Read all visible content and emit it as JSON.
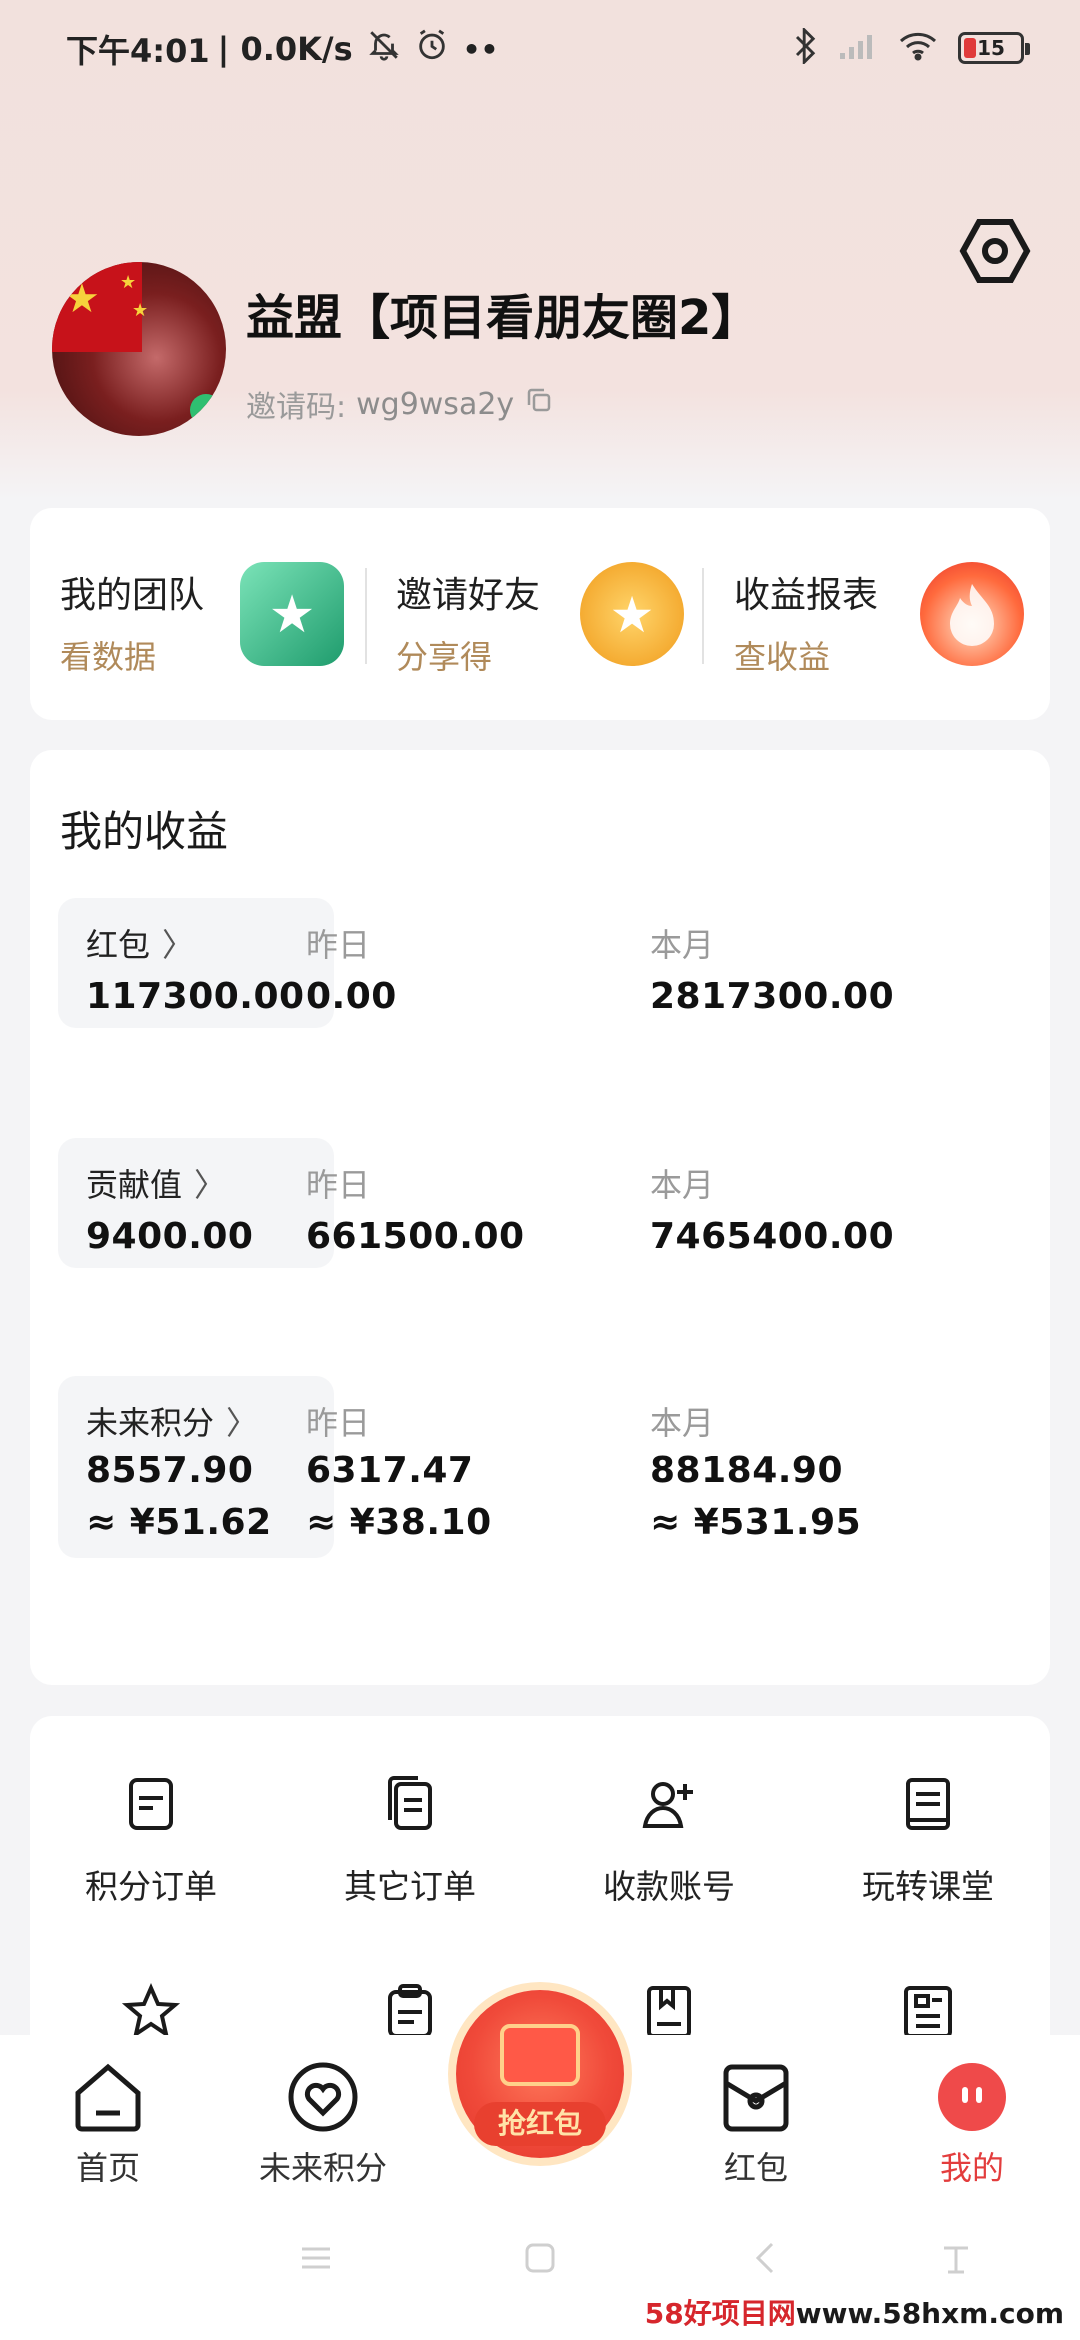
{
  "status_bar": {
    "time": "下午4:01",
    "speed": "| 0.0K/s",
    "battery": "15"
  },
  "profile": {
    "name": "益盟【项目看朋友圈2】",
    "invite_label": "邀请码: ",
    "invite_code": "wg9wsa2y"
  },
  "quick_links": [
    {
      "title": "我的团队",
      "sub": "看数据"
    },
    {
      "title": "邀请好友",
      "sub": "分享得"
    },
    {
      "title": "收益报表",
      "sub": "查收益"
    }
  ],
  "earnings": {
    "title": "我的收益",
    "yesterday_label": "昨日",
    "month_label": "本月",
    "rows": [
      {
        "name": "红包",
        "total": "117300.00",
        "yesterday": "0.00",
        "month": "2817300.00"
      },
      {
        "name": "贡献值",
        "total": "9400.00",
        "yesterday": "661500.00",
        "month": "7465400.00"
      },
      {
        "name": "未来积分",
        "total": "8557.90",
        "yesterday": "6317.47",
        "month": "88184.90",
        "total_cny": "≈ ¥51.62",
        "yesterday_cny": "≈ ¥38.10",
        "month_cny": "≈ ¥531.95"
      }
    ]
  },
  "menu": {
    "row1": [
      "积分订单",
      "其它订单",
      "收款账号",
      "玩转课堂"
    ]
  },
  "tabbar": {
    "tabs": [
      "首页",
      "未来积分",
      "红包",
      "我的"
    ],
    "grab_label": "抢红包",
    "active": "我的"
  },
  "watermark": {
    "brand": "58好项目网",
    "url": "www.58hxm.com"
  },
  "colors": {
    "accent_red": "#e33d3d",
    "gold_text": "#b08a5a",
    "hero_bg": "#f2e1dd"
  }
}
